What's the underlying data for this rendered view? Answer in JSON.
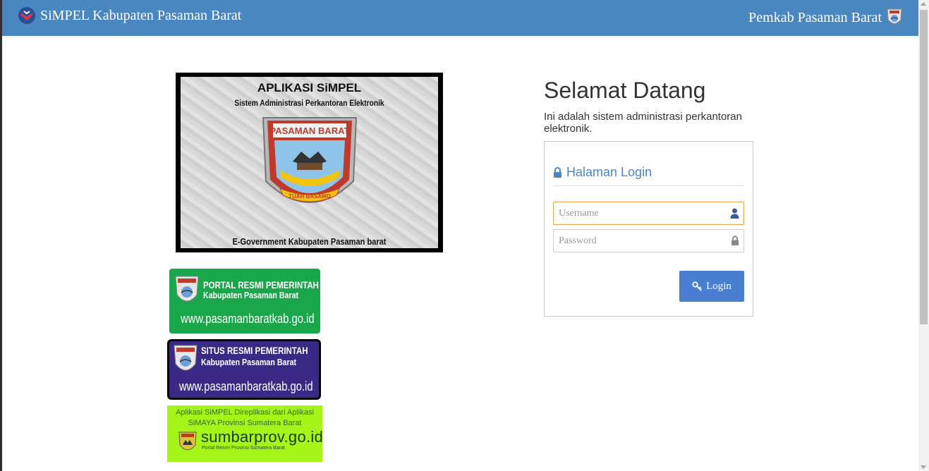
{
  "navbar": {
    "brand": "SiMPEL Kabupaten Pasaman Barat",
    "right_text": "Pemkab Pasaman Barat",
    "color": "#4a86c0"
  },
  "banner": {
    "title": "APLIKASI SiMPEL",
    "subtitle": "Sistem Administrasi Perkantoran Elektronik",
    "emblem_top": "PASAMAN BARAT",
    "emblem_ribbon": "TUAH BASAMO",
    "footer": "E-Government Kabupaten Pasaman barat"
  },
  "portals": [
    {
      "line1": "PORTAL RESMI PEMERINTAH",
      "line2": "Kabupaten Pasaman Barat",
      "url": "www.pasamanbaratkab.go.id",
      "color": "#1aa64a"
    },
    {
      "line1": "SITUS RESMI PEMERINTAH",
      "line2": "Kabupaten Pasaman Barat",
      "url": "www.pasamanbaratkab.go.id",
      "color": "#3a2a86"
    },
    {
      "line1": "Aplikasi SiMPEL Direplikasi dari Aplikasi",
      "line2": "SiMAYA Provinsi Sumatera Barat",
      "url": "sumbarprov.go.id",
      "sub": "Portal Resmi Provinsi Sumatera Barat",
      "color": "#a6f519"
    }
  ],
  "welcome": {
    "title": "Selamat Datang",
    "desc": "Ini adalah sistem administrasi perkantoran elektronik."
  },
  "login": {
    "panel_title": "Halaman Login",
    "username_placeholder": "Username",
    "password_placeholder": "Password",
    "button_label": "Login",
    "accent": "#4a7fd0",
    "focus_border": "#e8a14a"
  },
  "icons": [
    "shield-logo-icon",
    "crest-icon",
    "lock-icon",
    "user-icon",
    "key-icon"
  ]
}
